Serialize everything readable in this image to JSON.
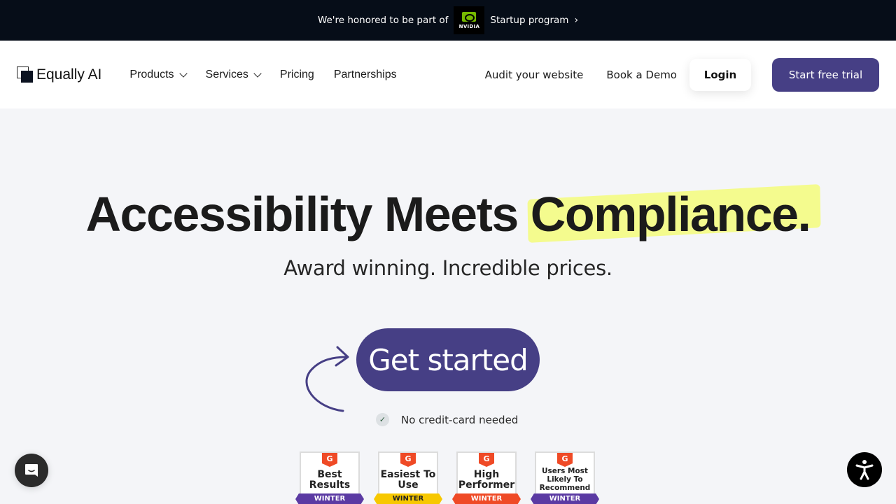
{
  "announcement": {
    "prefix": "We're honored to be part of",
    "partner_logo": "nvidia-logo",
    "partner_word": "NVIDIA",
    "suffix": "Startup program",
    "chevron": "›"
  },
  "nav": {
    "logo_text": "Equally AI",
    "left_items": [
      {
        "label": "Products",
        "has_dropdown": true
      },
      {
        "label": "Services",
        "has_dropdown": true
      },
      {
        "label": "Pricing",
        "has_dropdown": false
      },
      {
        "label": "Partnerships",
        "has_dropdown": false
      }
    ],
    "audit_label": "Audit your website",
    "demo_label": "Book a Demo",
    "login_label": "Login",
    "trial_label": "Start free trial"
  },
  "hero": {
    "headline_prefix": "Accessibility Meets ",
    "headline_highlight": "Compliance.",
    "subhead": "Award winning. Incredible prices.",
    "cta_label": "Get started",
    "note": "No credit-card needed",
    "check_glyph": "✓"
  },
  "badges": [
    {
      "g2": "G",
      "title": "Best Results",
      "season": "WINTER",
      "color": "#5b3aa3"
    },
    {
      "g2": "G",
      "title": "Easiest To Use",
      "season": "WINTER",
      "color": "#f7c800"
    },
    {
      "g2": "G",
      "title": "High Performer",
      "season": "WINTER",
      "color": "#ef4a26"
    },
    {
      "g2": "G",
      "title": "Users Most Likely To Recommend",
      "season": "WINTER",
      "color": "#5b3aa3"
    }
  ],
  "colors": {
    "brand": "#463f85",
    "highlight": "#f4fb8e",
    "announce_bg": "#060d18"
  },
  "widgets": {
    "chat_icon": "chat-icon",
    "accessibility_icon": "accessibility-icon"
  }
}
